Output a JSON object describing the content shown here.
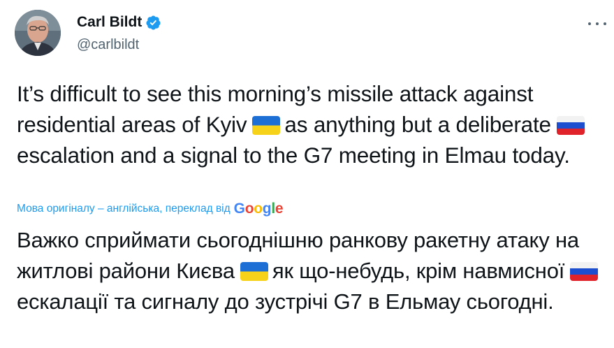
{
  "author": {
    "display_name": "Carl Bildt",
    "handle": "@carlbildt",
    "verified": true
  },
  "tweet": {
    "segments": [
      "It’s difficult to see this morning’s missile attack against residential areas of Kyiv",
      "as anything but a deliberate",
      "escalation and a signal to the G7 meeting in Elmau today."
    ],
    "flags": [
      "ukraine-flag",
      "russia-flag"
    ]
  },
  "translation": {
    "note": "Мова оригіналу – англійська, переклад від",
    "provider": [
      "G",
      "o",
      "o",
      "g",
      "l",
      "e"
    ],
    "segments": [
      "Важко сприймати сьогоднішню ранкову ракетну атаку на житлові райони Києва",
      "як що-небудь, крім навмисної",
      "ескалації та сигналу до зустрічі G7 в Ельмау сьогодні."
    ]
  },
  "colors": {
    "text": "#0f1419",
    "secondary": "#536471",
    "link": "#1d9bf0",
    "verified": "#1d9bf0"
  }
}
